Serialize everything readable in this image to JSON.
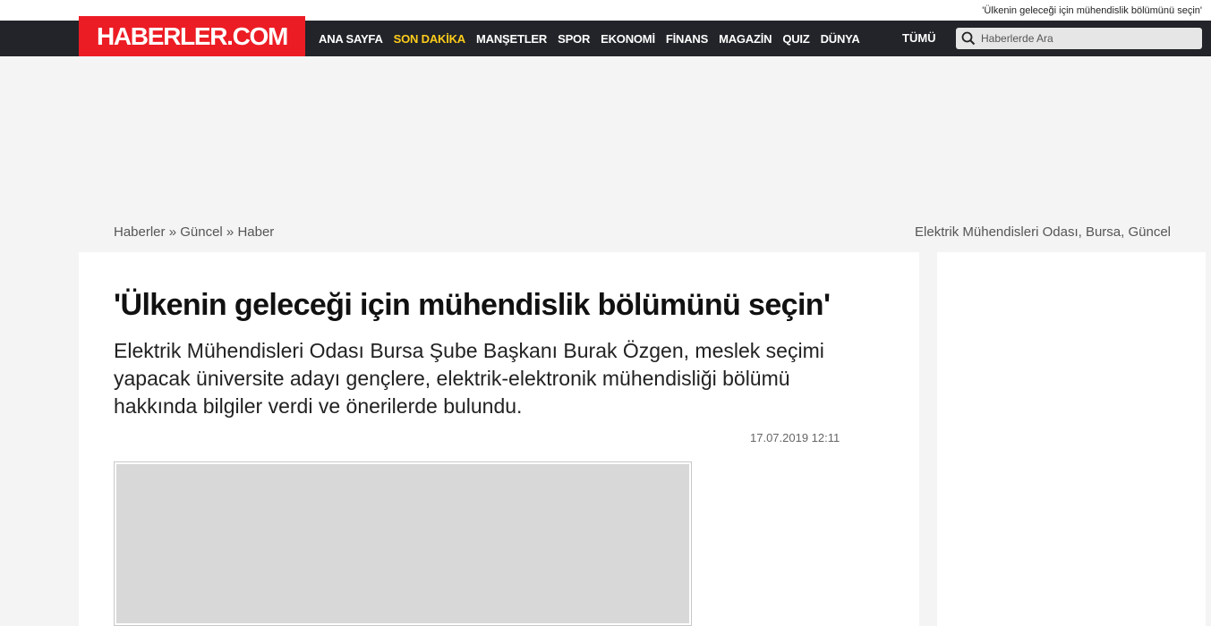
{
  "top_strip": {
    "text": "'Ülkenin geleceği için mühendislik bölümünü seçin'"
  },
  "logo": {
    "text": "HABERLER.COM"
  },
  "nav": {
    "items": [
      {
        "label": "ANA SAYFA",
        "highlight": false
      },
      {
        "label": "SON DAKİKA",
        "highlight": true
      },
      {
        "label": "MANŞETLER",
        "highlight": false
      },
      {
        "label": "SPOR",
        "highlight": false
      },
      {
        "label": "EKONOMİ",
        "highlight": false
      },
      {
        "label": "FİNANS",
        "highlight": false
      },
      {
        "label": "MAGAZİN",
        "highlight": false
      },
      {
        "label": "QUIZ",
        "highlight": false
      },
      {
        "label": "DÜNYA",
        "highlight": false
      }
    ],
    "all_label": "TÜMÜ"
  },
  "search": {
    "placeholder": "Haberlerde Ara"
  },
  "breadcrumb": {
    "home": "Haberler",
    "separator1": " » ",
    "category": "Güncel",
    "separator2": " » ",
    "current": "Haber"
  },
  "tags": {
    "text": "Elektrik Mühendisleri Odası, Bursa, Güncel"
  },
  "article": {
    "headline": "'Ülkenin geleceği için mühendislik bölümünü seçin'",
    "spot": "Elektrik Mühendisleri Odası Bursa Şube Başkanı Burak Özgen, meslek seçimi yapacak üniversite adayı gençlere, elektrik-elektronik mühendisliği bölümü hakkında bilgiler verdi ve önerilerde bulundu.",
    "date": "17.07.2019 12:11"
  },
  "colors": {
    "brand_red": "#ec1c24",
    "nav_bg": "#222429",
    "highlight": "#ffcc1a"
  }
}
